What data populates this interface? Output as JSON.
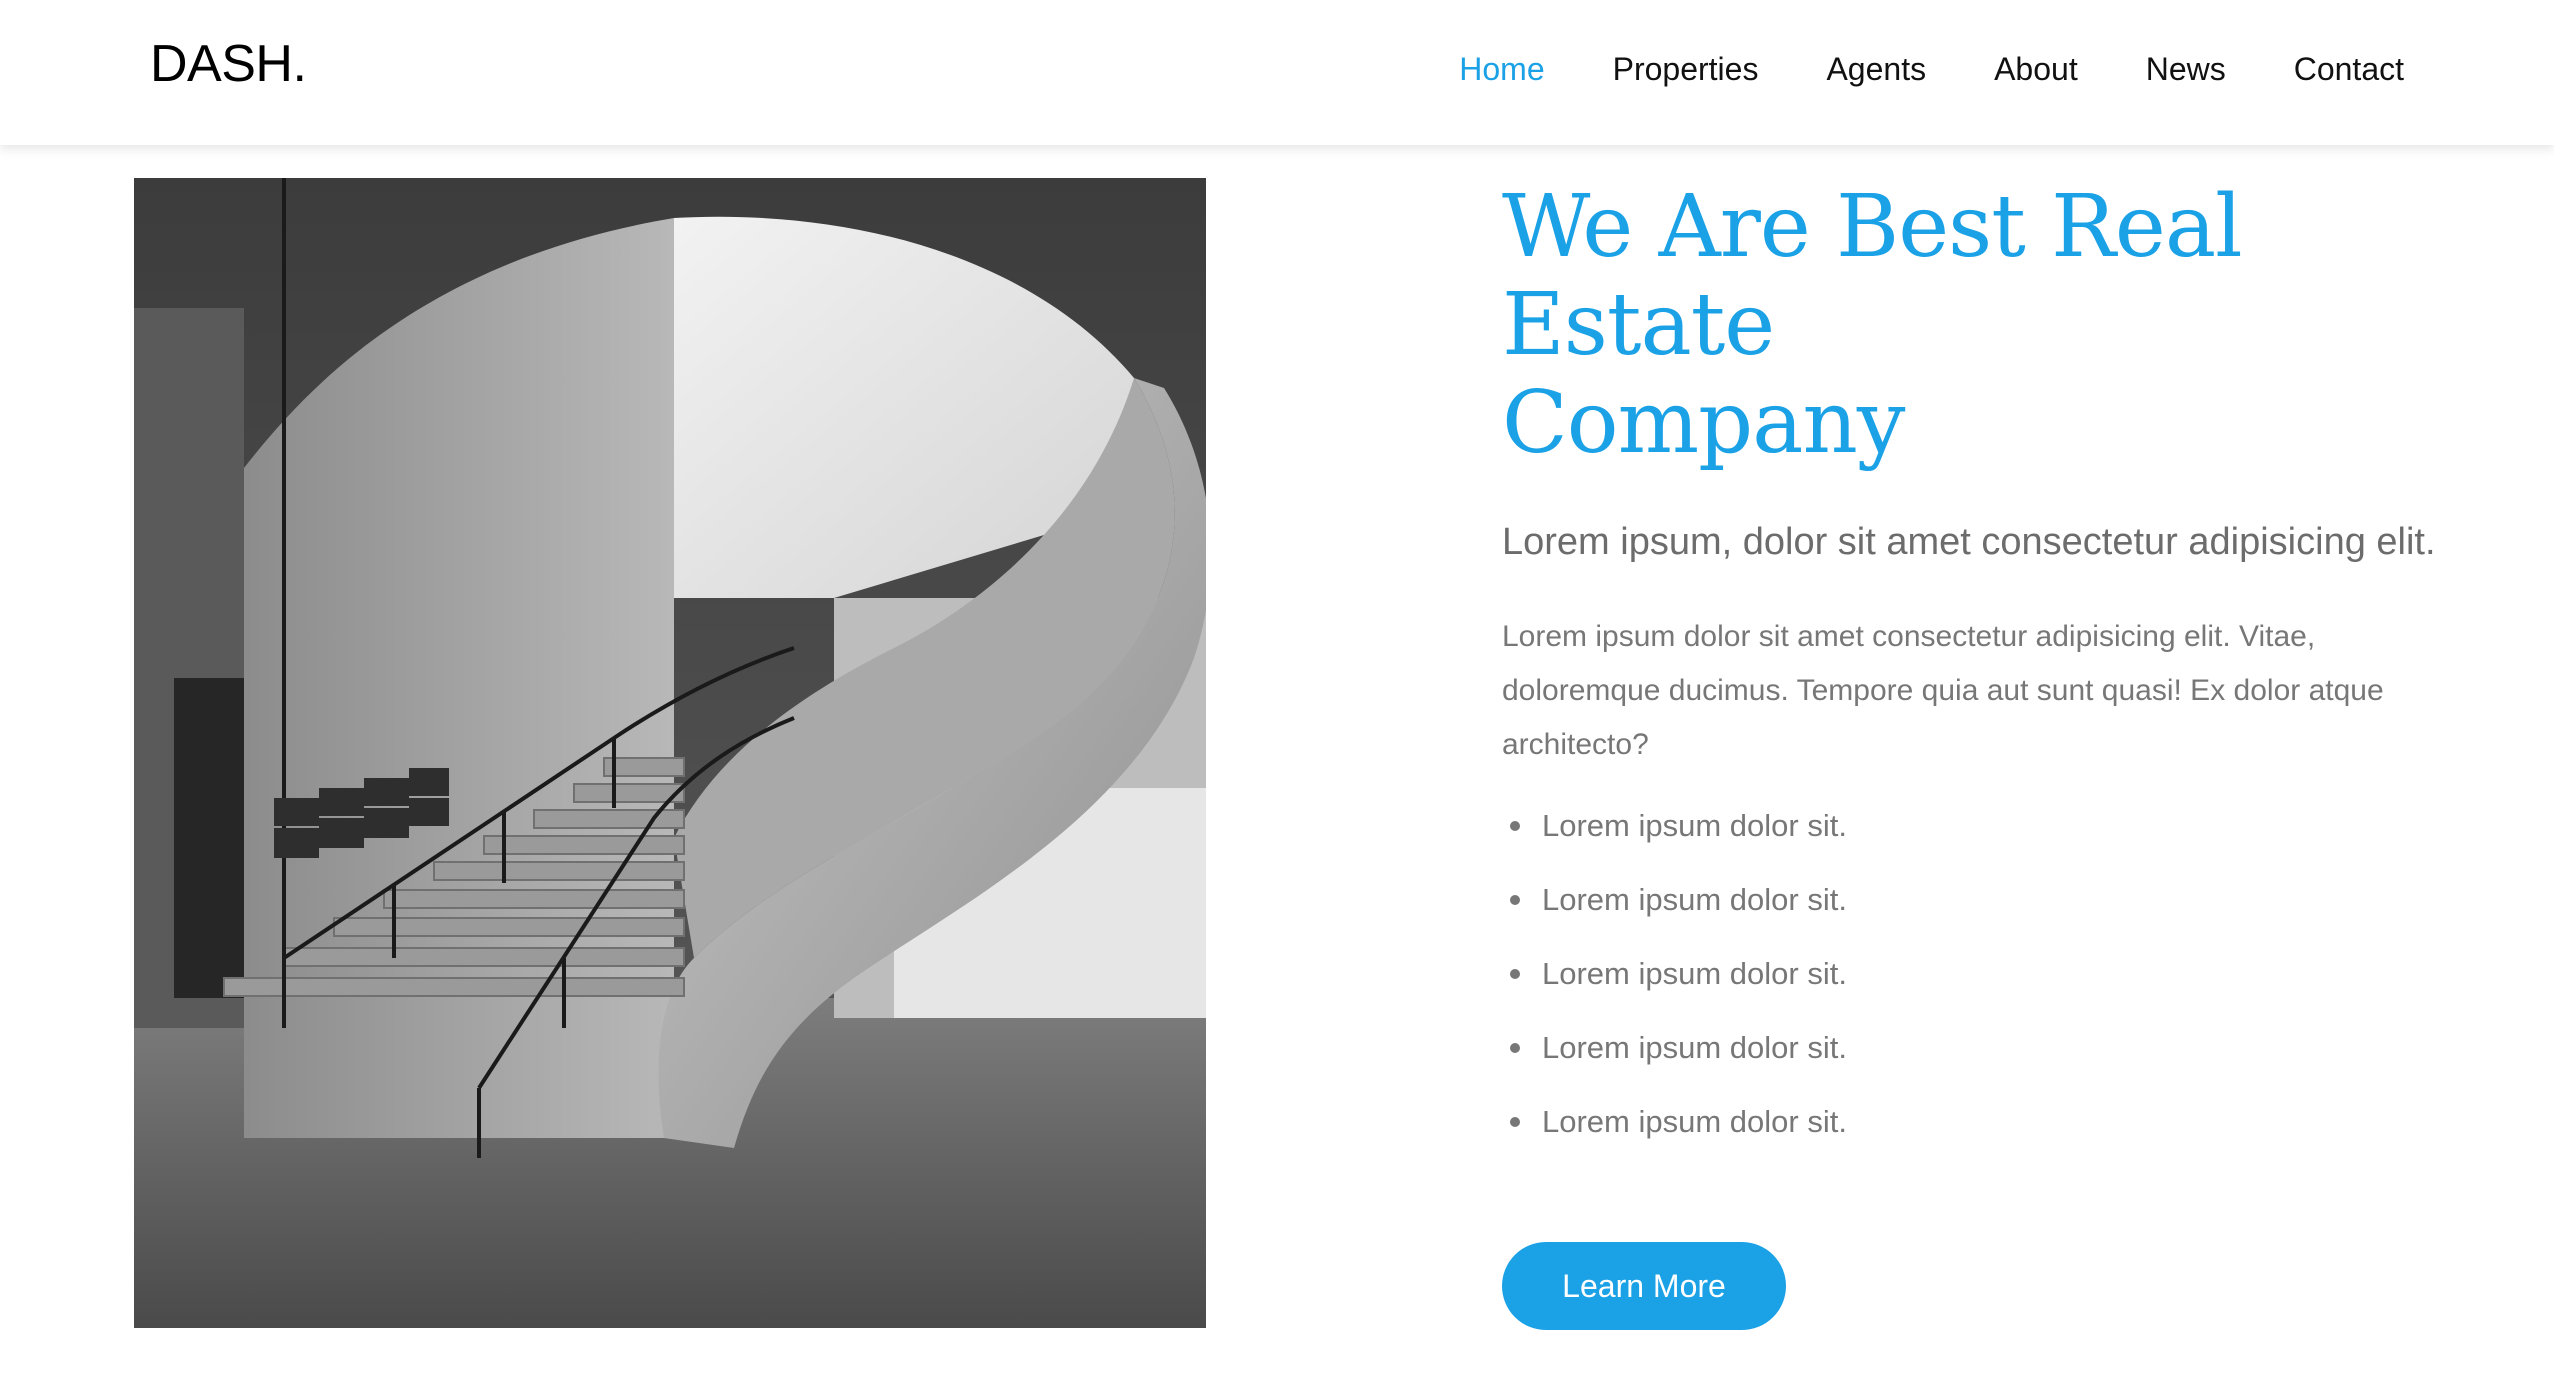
{
  "brand": {
    "name": "DASH."
  },
  "nav": {
    "items": [
      {
        "label": "Home",
        "active": true
      },
      {
        "label": "Properties",
        "active": false
      },
      {
        "label": "Agents",
        "active": false
      },
      {
        "label": "About",
        "active": false
      },
      {
        "label": "News",
        "active": false
      },
      {
        "label": "Contact",
        "active": false
      }
    ]
  },
  "hero": {
    "image": "spiral concrete staircase photo (black and white)",
    "headline_line1": "We Are Best Real Estate",
    "headline_line2": "Company",
    "lead": "Lorem ipsum, dolor sit amet consectetur adipisicing elit.",
    "body": "Lorem ipsum dolor sit amet consectetur adipisicing elit. Vitae, doloremque ducimus. Tempore quia aut sunt quasi! Ex dolor atque architecto?",
    "features": [
      "Lorem ipsum dolor sit.",
      "Lorem ipsum dolor sit.",
      "Lorem ipsum dolor sit.",
      "Lorem ipsum dolor sit.",
      "Lorem ipsum dolor sit."
    ],
    "cta_label": "Learn More"
  },
  "colors": {
    "accent": "#1ba1e6",
    "text_muted": "#777777",
    "nav_text": "#111111"
  }
}
